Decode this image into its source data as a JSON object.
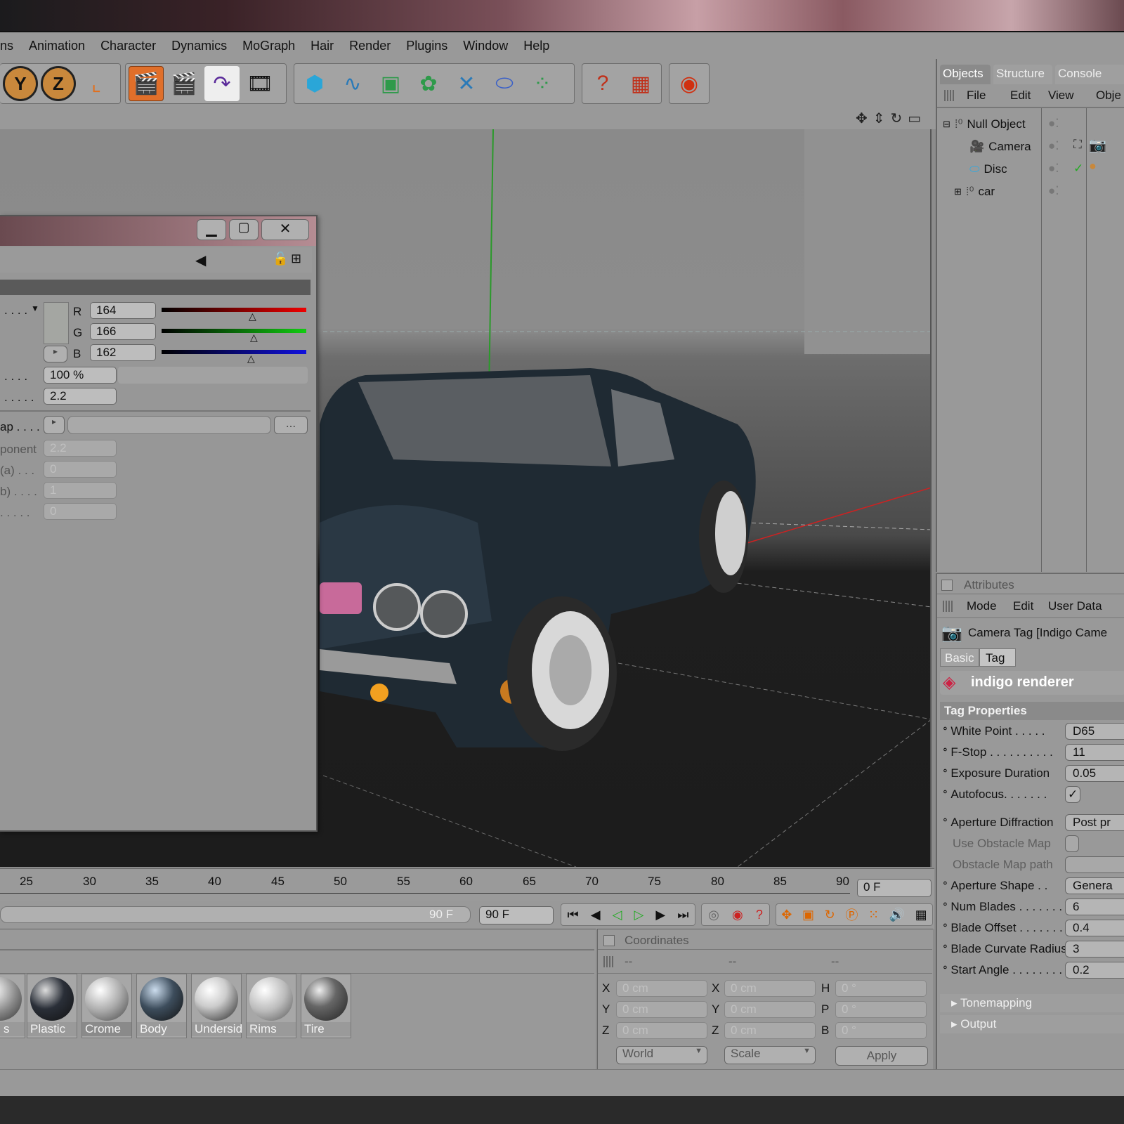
{
  "menu": [
    "ns",
    "Animation",
    "Character",
    "Dynamics",
    "MoGraph",
    "Hair",
    "Render",
    "Plugins",
    "Window",
    "Help"
  ],
  "toolbar": {
    "axis_y": "Y",
    "axis_z": "Z"
  },
  "color_panel": {
    "r_label": "R",
    "g_label": "G",
    "b_label": "B",
    "r_value": "164",
    "g_value": "166",
    "b_value": "162",
    "brightness": "100 %",
    "gamma": "2.2",
    "row_labels": [
      "ap . . . .",
      "ponent",
      "(a) . . .",
      "b) . . . .",
      ". . . . ."
    ],
    "exponent": "2.2",
    "a_value": "0",
    "b_value2": "1",
    "last_value": "0",
    "ellipsis": "..."
  },
  "timeline": {
    "ticks": [
      "25",
      "30",
      "35",
      "40",
      "45",
      "50",
      "55",
      "60",
      "65",
      "70",
      "75",
      "80",
      "85",
      "90"
    ],
    "current_frame": "0 F",
    "end_frame": "90 F",
    "end_frame2": "90 F"
  },
  "materials": [
    {
      "name": "s",
      "color": "#9a9a9a"
    },
    {
      "name": "Plastic",
      "color": "#2a2f38"
    },
    {
      "name": "Crome",
      "color": "#b8b8b8"
    },
    {
      "name": "Body",
      "color": "#3d4d5c"
    },
    {
      "name": "Undersid",
      "color": "#d8d8d8"
    },
    {
      "name": "Rims",
      "color": "#cfcfcf"
    },
    {
      "name": "Tire",
      "color": "#3a3a3a"
    }
  ],
  "coordinates": {
    "title": "Coordinates",
    "head": [
      "--",
      "--",
      "--"
    ],
    "col1": [
      "X",
      "Y",
      "Z"
    ],
    "col2": [
      "X",
      "Y",
      "Z"
    ],
    "col3": [
      "H",
      "P",
      "B"
    ],
    "pos": [
      "0 cm",
      "0 cm",
      "0 cm"
    ],
    "scale": [
      "0 cm",
      "0 cm",
      "0 cm"
    ],
    "rot": [
      "0 °",
      "0 °",
      "0 °"
    ],
    "mode1": "World",
    "mode2": "Scale",
    "apply": "Apply"
  },
  "objects_panel": {
    "tabs": [
      "Objects",
      "Structure",
      "Console"
    ],
    "menu": [
      "File",
      "Edit",
      "View",
      "Obje"
    ],
    "tree": [
      "Null Object",
      "Camera",
      "Disc",
      "car"
    ]
  },
  "attributes_panel": {
    "title": "Attributes",
    "menu": [
      "Mode",
      "Edit",
      "User Data"
    ],
    "object_title": "Camera Tag [Indigo Came",
    "tabs": [
      "Basic",
      "Tag"
    ],
    "brand": "indigo renderer",
    "section": "Tag Properties",
    "props": [
      {
        "label": "White Point . . . . .",
        "value": "D65",
        "dim": false
      },
      {
        "label": "F-Stop . . . . . . . . . .",
        "value": "11",
        "dim": false
      },
      {
        "label": "Exposure Duration",
        "value": "0.05",
        "dim": false
      },
      {
        "label": "Autofocus. . . . . . .",
        "value": "✓",
        "dim": false
      },
      {
        "label": "Aperture Diffraction",
        "value": "Post pr",
        "dim": false
      },
      {
        "label": "Use Obstacle Map",
        "value": "",
        "dim": true
      },
      {
        "label": "Obstacle Map path",
        "value": "",
        "dim": true
      },
      {
        "label": "Aperture Shape . .",
        "value": "Genera",
        "dim": false
      },
      {
        "label": "Num Blades . . . . . . . .",
        "value": "6",
        "dim": false
      },
      {
        "label": "Blade Offset . . . . . . .",
        "value": "0.4",
        "dim": false
      },
      {
        "label": "Blade Curvate Radius",
        "value": "3",
        "dim": false
      },
      {
        "label": "Start Angle . . . . . . . .",
        "value": "0.2",
        "dim": false
      }
    ],
    "collapsed": [
      "Tonemapping",
      "Output"
    ]
  }
}
